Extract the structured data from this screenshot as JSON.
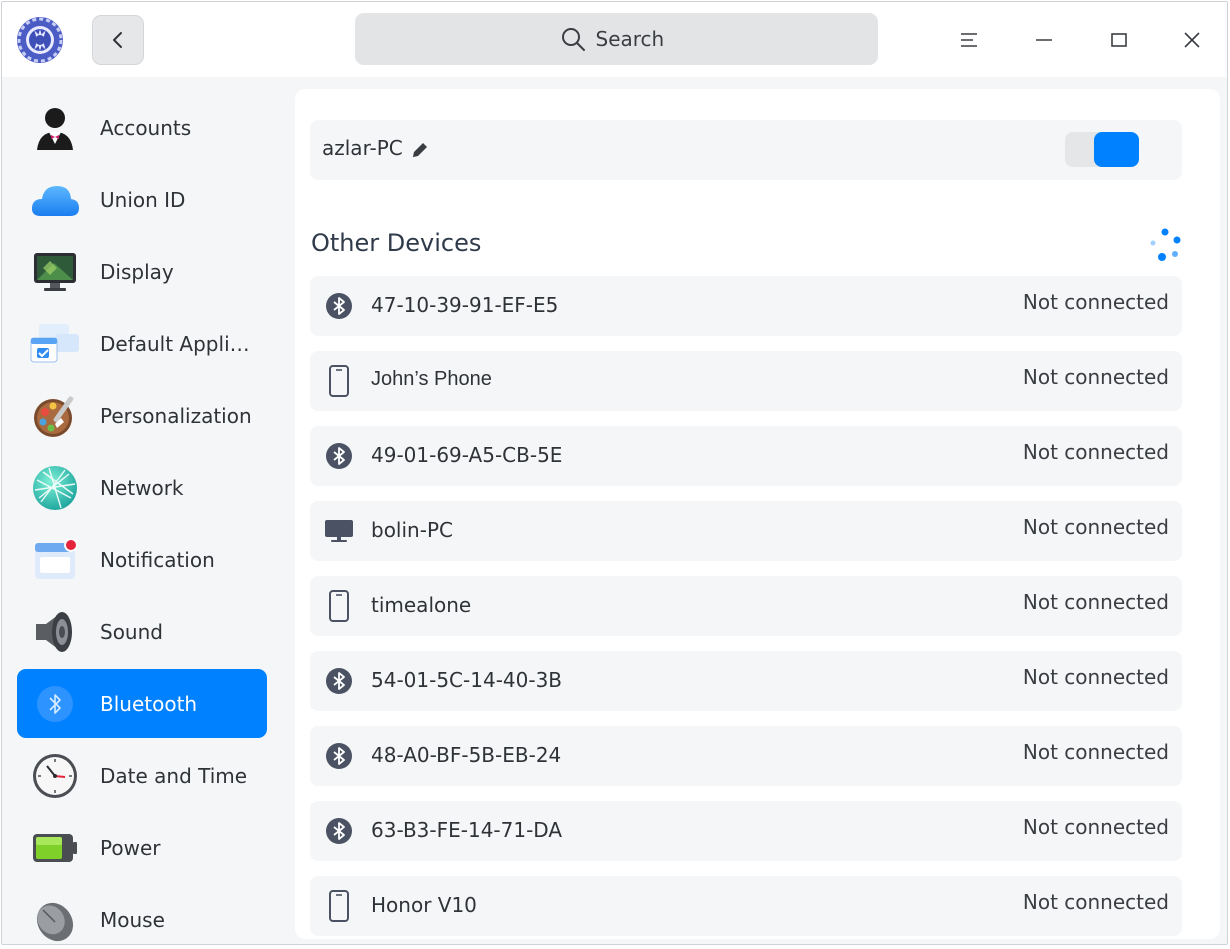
{
  "header": {
    "search_placeholder": "Search"
  },
  "sidebar": {
    "items": [
      {
        "label": "Accounts",
        "icon": "accounts-icon"
      },
      {
        "label": "Union ID",
        "icon": "cloud-icon"
      },
      {
        "label": "Display",
        "icon": "display-icon"
      },
      {
        "label": "Default Applications",
        "icon": "default-apps-icon"
      },
      {
        "label": "Personalization",
        "icon": "palette-icon"
      },
      {
        "label": "Network",
        "icon": "network-icon"
      },
      {
        "label": "Notification",
        "icon": "notification-icon"
      },
      {
        "label": "Sound",
        "icon": "speaker-icon"
      },
      {
        "label": "Bluetooth",
        "icon": "bluetooth-icon",
        "selected": true
      },
      {
        "label": "Date and Time",
        "icon": "clock-icon"
      },
      {
        "label": "Power",
        "icon": "battery-icon"
      },
      {
        "label": "Mouse",
        "icon": "mouse-icon"
      }
    ]
  },
  "bluetooth": {
    "host_name": "azlar-PC",
    "enabled": true,
    "section_title": "Other Devices",
    "devices": [
      {
        "name": "47-10-39-91-EF-E5",
        "status": "Not connected",
        "icon": "bluetooth-icon"
      },
      {
        "name": "John’s Phone",
        "status": "Not connected",
        "icon": "phone-icon"
      },
      {
        "name": "49-01-69-A5-CB-5E",
        "status": "Not connected",
        "icon": "bluetooth-icon"
      },
      {
        "name": "bolin-PC",
        "status": "Not connected",
        "icon": "computer-icon"
      },
      {
        "name": "timealone",
        "status": "Not connected",
        "icon": "phone-icon"
      },
      {
        "name": "54-01-5C-14-40-3B",
        "status": "Not connected",
        "icon": "bluetooth-icon"
      },
      {
        "name": "48-A0-BF-5B-EB-24",
        "status": "Not connected",
        "icon": "bluetooth-icon"
      },
      {
        "name": "63-B3-FE-14-71-DA",
        "status": "Not connected",
        "icon": "bluetooth-icon"
      },
      {
        "name": "Honor V10",
        "status": "Not connected",
        "icon": "phone-icon"
      }
    ]
  },
  "colors": {
    "accent": "#0081ff",
    "row_background": "#f5f6f7",
    "window_background": "#f5f6f7"
  }
}
